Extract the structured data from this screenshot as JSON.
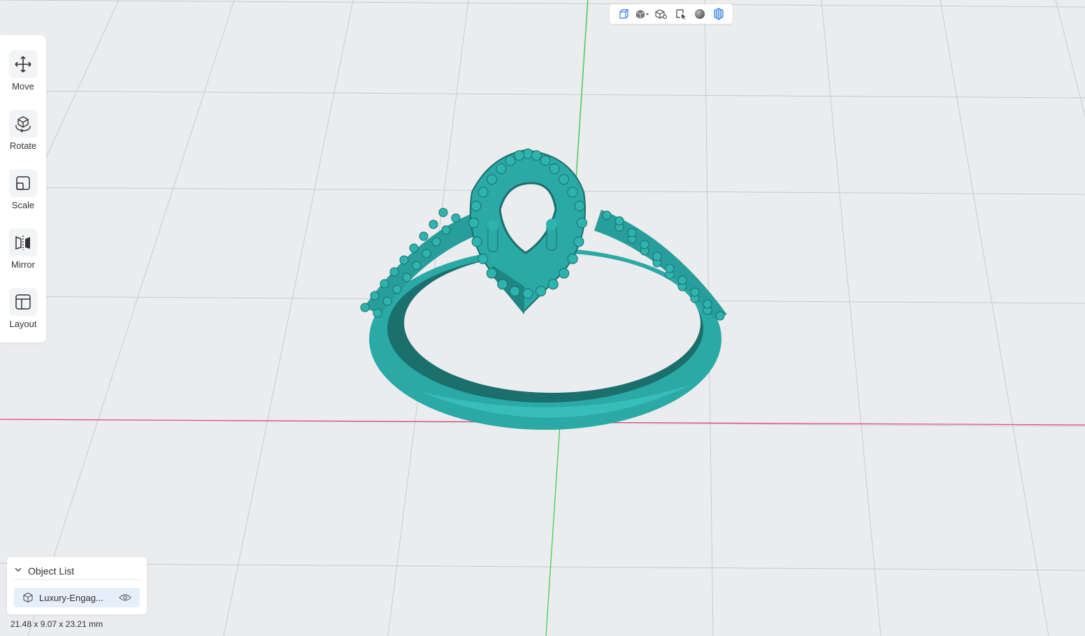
{
  "colors": {
    "background": "#ebecee",
    "grid": "#c8cacd",
    "axis_x": "#e0457b",
    "axis_y": "#35d04a",
    "model": "#2aa9a6",
    "model_dark": "#1b6f6c",
    "accent": "#2f7fe0"
  },
  "view_toolbar": {
    "buttons": [
      {
        "icon": "view-front-icon"
      },
      {
        "icon": "view-cube-dropdown-icon"
      },
      {
        "icon": "zoom-fit-icon"
      },
      {
        "icon": "select-area-icon"
      },
      {
        "icon": "shading-sphere-icon"
      },
      {
        "icon": "wireframe-mode-icon"
      }
    ]
  },
  "tools": [
    {
      "label": "Move",
      "icon": "move-icon"
    },
    {
      "label": "Rotate",
      "icon": "rotate-icon"
    },
    {
      "label": "Scale",
      "icon": "scale-icon"
    },
    {
      "label": "Mirror",
      "icon": "mirror-icon"
    },
    {
      "label": "Layout",
      "icon": "layout-icon"
    }
  ],
  "object_list": {
    "title": "Object List",
    "items": [
      {
        "name": "Luxury-Engag...",
        "icon": "cube-icon",
        "visible": true
      }
    ]
  },
  "dimensions": "21.48 x 9.07 x 23.21 mm"
}
